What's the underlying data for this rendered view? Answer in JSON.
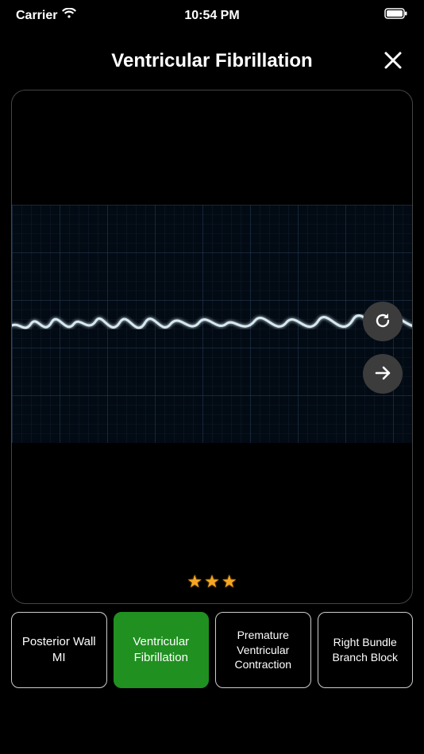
{
  "status": {
    "carrier": "Carrier",
    "time": "10:54 PM"
  },
  "header": {
    "title": "Ventricular Fibrillation"
  },
  "actions": {
    "reload": "reload",
    "next": "next"
  },
  "rating": {
    "stars_filled": 3,
    "stars_total": 3
  },
  "answers": [
    {
      "label": "Posterior Wall MI",
      "state": "default"
    },
    {
      "label": "Ventricular Fibrillation",
      "state": "correct"
    },
    {
      "label": "Premature Ventricular Contraction",
      "state": "default"
    },
    {
      "label": "Right Bundle Branch Block",
      "state": "default"
    }
  ]
}
